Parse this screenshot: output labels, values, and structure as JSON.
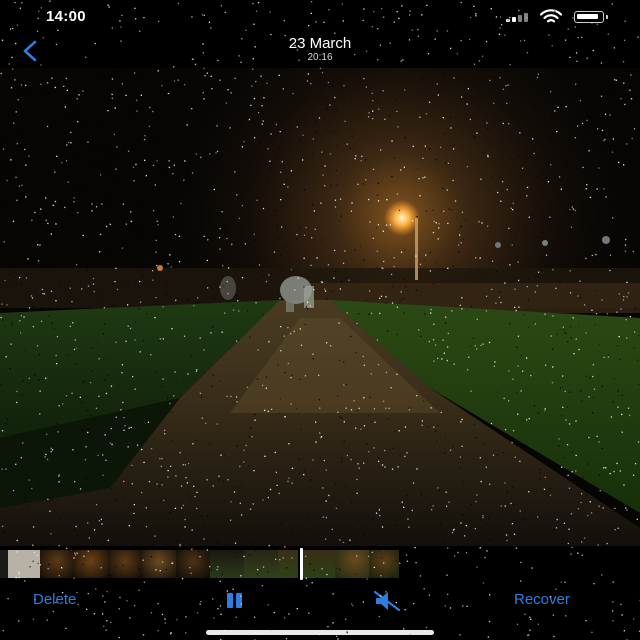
{
  "status_bar": {
    "time": "14:00"
  },
  "nav": {
    "title": "23 March",
    "subtitle": "20:16"
  },
  "toolbar": {
    "delete_label": "Delete",
    "recover_label": "Recover"
  },
  "icons": {
    "back": "chevron-left-icon",
    "pause": "pause-icon",
    "mute": "speaker-muted-icon",
    "signal": "cellular-signal-icon",
    "wifi": "wifi-icon",
    "battery": "battery-icon"
  },
  "colors": {
    "accent": "#2f7de1",
    "background": "#000000"
  },
  "scrubber": {
    "playhead_position": 0.47
  }
}
